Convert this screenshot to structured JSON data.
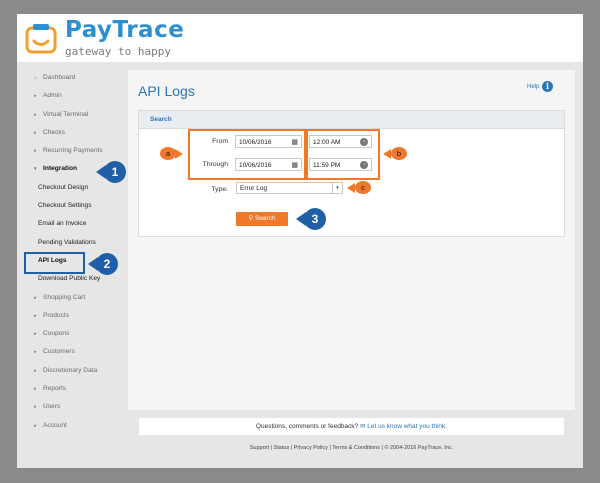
{
  "brand": {
    "name": "PayTrace",
    "tagline": "gateway to happy"
  },
  "sidebar": {
    "items": [
      {
        "label": "Dashboard",
        "caret": "⌂"
      },
      {
        "label": "Admin",
        "caret": "▸"
      },
      {
        "label": "Virtual Terminal",
        "caret": "▸"
      },
      {
        "label": "Checks",
        "caret": "▸"
      },
      {
        "label": "Recurring Payments",
        "caret": "▸"
      },
      {
        "label": "Integration",
        "caret": "▾"
      },
      {
        "label": "Checkout Design"
      },
      {
        "label": "Checkout Settings"
      },
      {
        "label": "Email an Invoice"
      },
      {
        "label": "Pending Validations"
      },
      {
        "label": "API Logs"
      },
      {
        "label": "Download Public Key"
      },
      {
        "label": "Shopping Cart",
        "caret": "▸"
      },
      {
        "label": "Products",
        "caret": "▸"
      },
      {
        "label": "Coupons",
        "caret": "▸"
      },
      {
        "label": "Customers",
        "caret": "▸"
      },
      {
        "label": "Discretionary Data",
        "caret": "▸"
      },
      {
        "label": "Reports",
        "caret": "▸"
      },
      {
        "label": "Users",
        "caret": "▸"
      },
      {
        "label": "Account",
        "caret": "▸"
      }
    ]
  },
  "page": {
    "title": "API Logs",
    "help": "Help"
  },
  "search": {
    "panel_title": "Search",
    "from_label": "From",
    "through_label": "Through",
    "from_date": "10/06/2016",
    "through_date": "10/06/2016",
    "from_time": "12:00 AM",
    "through_time": "11:59 PM",
    "type_label": "Type:",
    "type_value": "Error Log",
    "button_label": "Search"
  },
  "callouts": {
    "a": "a",
    "b": "b",
    "c": "c",
    "n1": "1",
    "n2": "2",
    "n3": "3"
  },
  "feedback": {
    "text": "Questions, comments or feedback?",
    "link": "Let us know what you think."
  },
  "footer": {
    "text": "Support | Status | Privacy Policy | Terms & Conditions | © 2004-2016 PayTrace, Inc."
  },
  "colors": {
    "accent": "#2b74b8",
    "orange": "#f0782b",
    "callout_blue": "#1f5fa8"
  }
}
